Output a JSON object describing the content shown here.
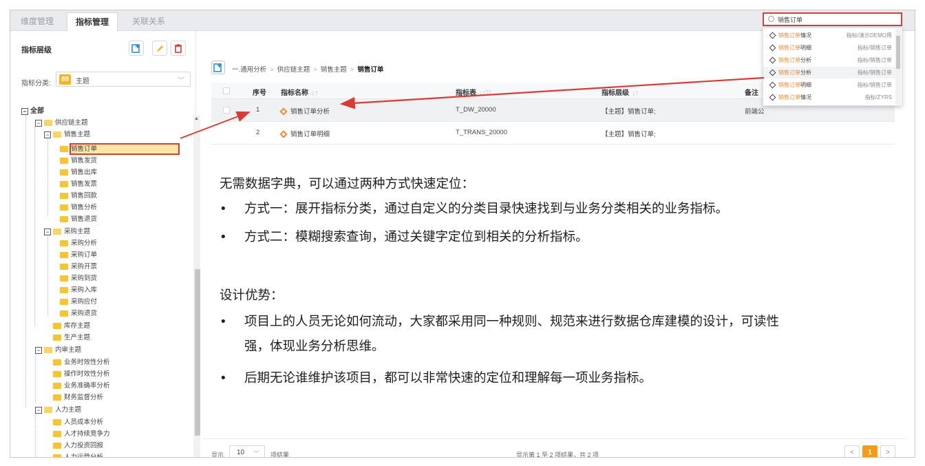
{
  "tabs": [
    "维度管理",
    "指标管理",
    "关联关系"
  ],
  "left": {
    "title": "指标层级",
    "category_label": "指标分类:",
    "category_value": "主题",
    "category_badge": "88",
    "tree": {
      "root": "全部",
      "n1": "供应链主题",
      "n1a": "销售主题",
      "n1a1": "销售订单",
      "n1a2": "销售发货",
      "n1a3": "销售出库",
      "n1a4": "销售发票",
      "n1a5": "销售回款",
      "n1a6": "销售分析",
      "n1a7": "销售退货",
      "n1b": "采购主题",
      "n1b1": "采购分析",
      "n1b2": "采购订单",
      "n1b3": "采购开票",
      "n1b4": "采购到货",
      "n1b5": "采购入库",
      "n1b6": "采购应付",
      "n1b7": "采购退货",
      "n1c": "库存主题",
      "n1d": "生产主题",
      "n2": "内审主题",
      "n2a": "业务时效性分析",
      "n2b": "操作时效性分析",
      "n2c": "业务准确率分析",
      "n2d": "财务监督分析",
      "n3": "人力主题",
      "n3a": "人员成本分析",
      "n3b": "人才持续竞争力",
      "n3c": "人力投资回报",
      "n3d": "人力运营分析"
    }
  },
  "breadcrumb": [
    "一.通用分析",
    "供应链主题",
    "销售主题",
    "销售订单"
  ],
  "table": {
    "headers": [
      "序号",
      "指标名称",
      "指标表",
      "指标层级",
      "备注"
    ],
    "rows": [
      {
        "no": "1",
        "name": "销售订单分析",
        "tbl": "T_DW_20000",
        "level": "【主题】销售订单;",
        "note": "前端公"
      },
      {
        "no": "2",
        "name": "销售订单明细",
        "tbl": "T_TRANS_20000",
        "level": "【主题】销售订单;",
        "note": ""
      }
    ]
  },
  "content": {
    "intro": "无需数据字典，可以通过两种方式快速定位：",
    "way1": "方式一：展开指标分类，通过自定义的分类目录快速找到与业务分类相关的业务指标。",
    "way2": "方式二：模糊搜索查询，通过关键字定位到相关的分析指标。",
    "adv_title": "设计优势：",
    "adv1a": "项目上的人员无论如何流动，大家都采用同一种规则、规范来进行数据仓库建模的设计，可读性",
    "adv1b": "强，体现业务分析思维。",
    "adv2": "后期无论谁维护该项目，都可以非常快速的定位和理解每一项业务指标。"
  },
  "footer": {
    "show": "显示",
    "page_size": "10",
    "results": "项结果",
    "info": "显示第 1 至 2 项结果，共 2 项",
    "page": "1",
    "prev": "<",
    "next": ">"
  },
  "search": {
    "value": "销售订单",
    "results": [
      {
        "hit": "销售订单",
        "rest": "情况",
        "path": "指标/演示DEMO用"
      },
      {
        "hit": "销售订单",
        "rest": "明细",
        "path": "指标/销售订单"
      },
      {
        "hit": "销售订单",
        "rest": "分析",
        "path": "指标/销售订单"
      },
      {
        "hit": "销售订单",
        "rest": "分析",
        "path": "指标/销售订单"
      },
      {
        "hit": "销售订单",
        "rest": "明细",
        "path": "指标/销售订单"
      },
      {
        "hit": "销售订单",
        "rest": "情况",
        "path": "指标/ZYRS"
      }
    ]
  },
  "colors": {
    "accent": "#f49b18",
    "highlight": "#d83a34",
    "orange": "#f08a2e"
  }
}
